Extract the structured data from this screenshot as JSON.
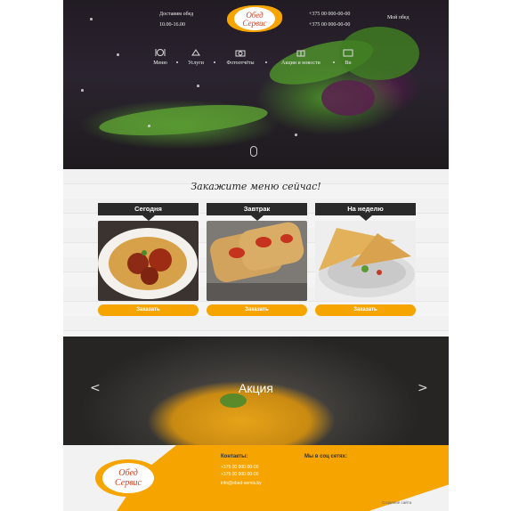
{
  "header": {
    "delivery_label": "Доставим обед",
    "delivery_hours": "10.00-16.00",
    "phone_1": "+375 00 000-00-00",
    "phone_2": "+375 00 000-00-00",
    "account_link": "Мой обед",
    "logo_line_1": "Обед",
    "logo_line_2": "Сервис"
  },
  "nav": {
    "items": [
      {
        "label": "Меню",
        "icon": "cutlery-icon"
      },
      {
        "label": "Услуги",
        "icon": "service-icon"
      },
      {
        "label": "Фотоотчёты",
        "icon": "camera-icon"
      },
      {
        "label": "Акции и новости",
        "icon": "gift-icon"
      },
      {
        "label": "Ви",
        "icon": "video-icon"
      }
    ]
  },
  "order": {
    "title": "Закажите меню сейчас!",
    "cards": [
      {
        "label": "Сегодня",
        "button": "Заказать"
      },
      {
        "label": "Завтрак",
        "button": "Заказать"
      },
      {
        "label": "На неделю",
        "button": "Заказать"
      }
    ]
  },
  "promo": {
    "title": "Акция",
    "prev": "<",
    "next": ">"
  },
  "footer": {
    "contacts_title": "Контакты:",
    "social_title": "Мы в соц сетях:",
    "contact_lines": [
      "+375 00 000-00-00",
      "+375 00 000-00-00",
      "info@obed-servis.by"
    ],
    "credit": "Создание сайта"
  },
  "colors": {
    "accent": "#f5a400",
    "dark_bar": "#2a2a2a"
  }
}
